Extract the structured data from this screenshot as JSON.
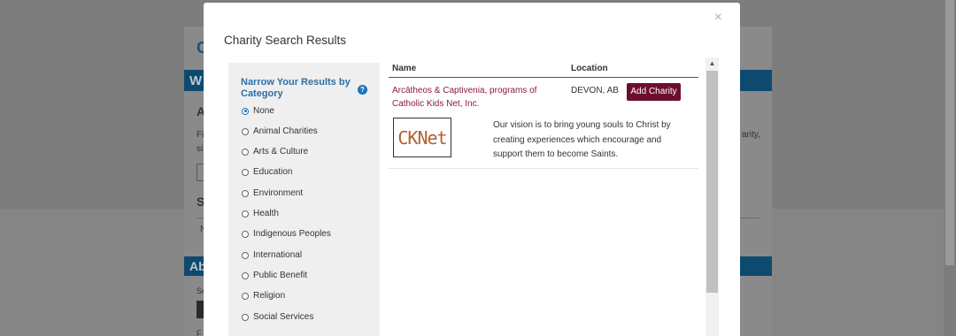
{
  "background": {
    "heading_initial": "C",
    "bar1_text": "W",
    "section_a": "A",
    "para_line1": "Fi",
    "para_line2": "si",
    "right_line1": "arity,",
    "right_line2": "",
    "section_s": "S",
    "row_n": "N",
    "bar2_text": "Ab",
    "label_se": "Se",
    "label_f": "F"
  },
  "modal": {
    "title": "Charity Search Results",
    "close_icon": "×",
    "filter": {
      "heading": "Narrow Your Results by Category",
      "help_icon": "?",
      "options": [
        {
          "label": "None",
          "checked": true
        },
        {
          "label": "Animal Charities",
          "checked": false
        },
        {
          "label": "Arts & Culture",
          "checked": false
        },
        {
          "label": "Education",
          "checked": false
        },
        {
          "label": "Environment",
          "checked": false
        },
        {
          "label": "Health",
          "checked": false
        },
        {
          "label": "Indigenous Peoples",
          "checked": false
        },
        {
          "label": "International",
          "checked": false
        },
        {
          "label": "Public Benefit",
          "checked": false
        },
        {
          "label": "Religion",
          "checked": false
        },
        {
          "label": "Social Services",
          "checked": false
        }
      ]
    },
    "results": {
      "columns": {
        "name": "Name",
        "location": "Location"
      },
      "rows": [
        {
          "name": "Arcātheos & Captivenia, programs of Catholic Kids Net, Inc.",
          "location": "DEVON, AB",
          "button": "Add Charity",
          "logo_text": "CKNet",
          "description": "Our vision is to bring young souls to Christ by creating experiences which encourage and support them to become Saints."
        }
      ]
    },
    "scroll_up_icon": "▲"
  },
  "colors": {
    "accent_link": "#8a1c3b",
    "button_bg": "#6d0f2c",
    "filter_heading": "#2a6fa8",
    "radio_checked": "#1e73b8"
  }
}
